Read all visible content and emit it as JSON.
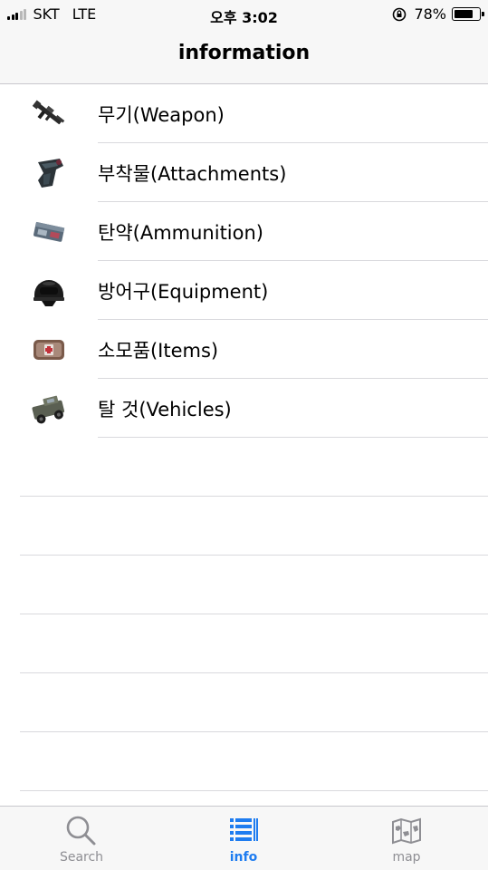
{
  "status_bar": {
    "carrier": "SKT",
    "network": "LTE",
    "time": "오후 3:02",
    "battery_percent": "78%",
    "battery_level": 0.78
  },
  "nav": {
    "title": "information"
  },
  "categories": [
    {
      "label": "무기(Weapon)",
      "icon": "rifle-icon"
    },
    {
      "label": "부착물(Attachments)",
      "icon": "grip-attachment-icon"
    },
    {
      "label": "탄약(Ammunition)",
      "icon": "ammo-box-icon"
    },
    {
      "label": "방어구(Equipment)",
      "icon": "helmet-icon"
    },
    {
      "label": "소모품(Items)",
      "icon": "medkit-icon"
    },
    {
      "label": "탈 것(Vehicles)",
      "icon": "vehicle-icon"
    }
  ],
  "tabs": [
    {
      "label": "Search",
      "icon": "magnifier-icon",
      "active": false
    },
    {
      "label": "info",
      "icon": "list-icon",
      "active": true
    },
    {
      "label": "map",
      "icon": "map-icon",
      "active": false
    }
  ],
  "colors": {
    "accent": "#1e7cf0",
    "inactive": "#8e8e93",
    "bar_bg": "#f7f7f7",
    "separator": "#d9d9dd"
  }
}
